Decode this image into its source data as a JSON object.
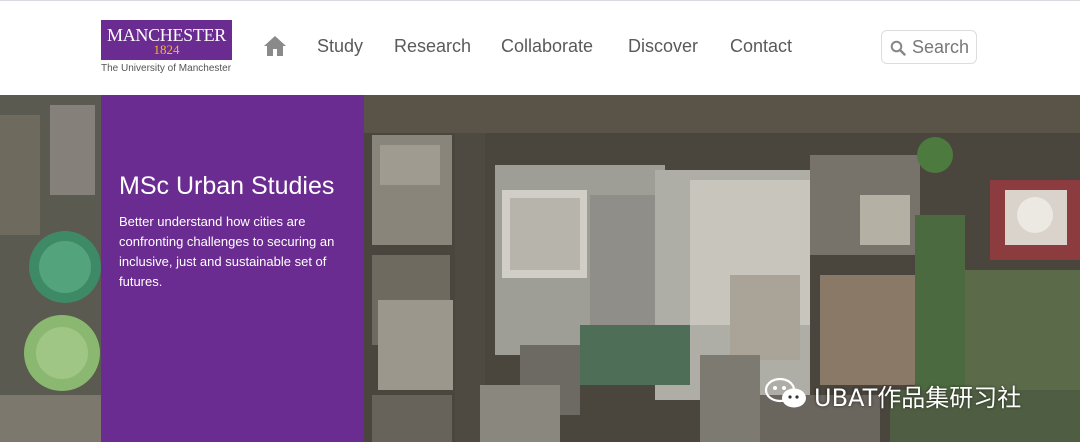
{
  "logo": {
    "wordmark": "MANCHESTER",
    "year": "1824",
    "subtitle": "The University of Manchester"
  },
  "nav": {
    "home_icon": "home-icon",
    "items": [
      "Study",
      "Research",
      "Collaborate",
      "Discover",
      "Contact"
    ]
  },
  "search": {
    "icon": "search-icon",
    "placeholder": "Search"
  },
  "hero": {
    "title": "MSc Urban Studies",
    "description": "Better understand how cities are confronting challenges to securing an inclusive, just and sustainable set of futures."
  },
  "watermark": {
    "icon": "wechat-icon",
    "text": "UBAT作品集研习社"
  },
  "colors": {
    "brand_purple": "#6b2c91",
    "brand_gold": "#f6b91e",
    "nav_text": "#5a5a5a"
  }
}
